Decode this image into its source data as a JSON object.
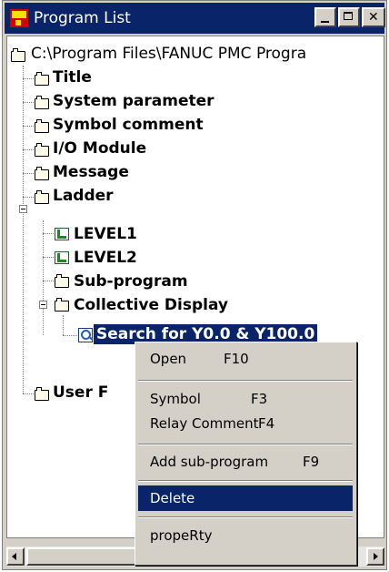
{
  "window": {
    "title": "Program List"
  },
  "tree": {
    "root": "C:\\Program Files\\FANUC PMC Progra",
    "items": [
      {
        "label": "Title"
      },
      {
        "label": "System parameter"
      },
      {
        "label": "Symbol comment"
      },
      {
        "label": "I/O Module"
      },
      {
        "label": "Message"
      },
      {
        "label": "Ladder"
      },
      {
        "label": "LEVEL1"
      },
      {
        "label": "LEVEL2"
      },
      {
        "label": "Sub-program"
      },
      {
        "label": "Collective Display"
      },
      {
        "label": "Search for Y0.0 & Y100.0"
      },
      {
        "label": "User F"
      }
    ]
  },
  "context_menu": {
    "items": [
      {
        "label": "Open",
        "key": "F10"
      },
      {
        "label": "Symbol",
        "key": "F3"
      },
      {
        "label": "Relay Comment",
        "key": "F4"
      },
      {
        "label": "Add sub-program",
        "key": "F9"
      },
      {
        "label": "Delete",
        "key": ""
      },
      {
        "label": "propeRty",
        "key": ""
      }
    ],
    "highlighted": "Delete"
  },
  "colors": {
    "titlebar": "#0a246a",
    "selection": "#0a246a",
    "chrome": "#d4d0c8"
  }
}
